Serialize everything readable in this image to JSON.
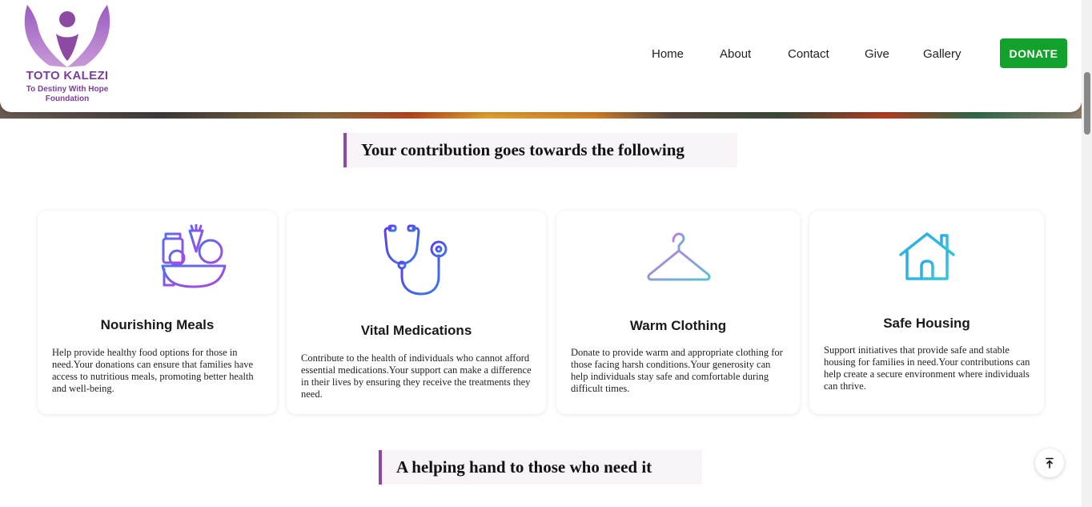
{
  "brand": {
    "name": "TOTO KALEZI",
    "tagline_line1": "To Destiny With Hope",
    "tagline_line2": "Foundation"
  },
  "nav": {
    "items": [
      "Home",
      "About",
      "Contact",
      "Give",
      "Gallery"
    ],
    "donate_label": "DONATE"
  },
  "sections": {
    "contribution_title": "Your contribution goes towards the following",
    "helping_title": "A helping hand to those who need it"
  },
  "cards": [
    {
      "title": "Nourishing Meals",
      "icon": "food-basket-icon",
      "text": "Help provide healthy food options for those in need.Your donations can ensure that families have access to nutritious meals, promoting better health and well-being."
    },
    {
      "title": "Vital Medications",
      "icon": "stethoscope-icon",
      "text": "Contribute to the health of individuals who cannot afford essential medications.Your support can make a difference in their lives by ensuring they receive the treatments they need."
    },
    {
      "title": "Warm Clothing",
      "icon": "hanger-icon",
      "text": "Donate to provide warm and appropriate clothing for those facing harsh conditions.Your generosity can help individuals stay safe and comfortable during difficult times."
    },
    {
      "title": "Safe Housing",
      "icon": "house-icon",
      "text": "Support initiatives that provide safe and stable housing for families in need.Your contributions can help create a secure environment where individuals can thrive."
    }
  ],
  "colors": {
    "brand_purple": "#8e4aa3",
    "donate_green": "#12a12a"
  },
  "back_to_top_icon": "arrow-up-to-line-icon"
}
